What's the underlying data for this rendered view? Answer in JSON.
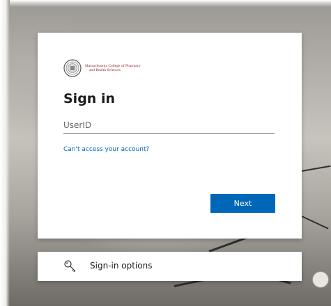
{
  "logo": {
    "line1": "Massachusetts College of Pharmacy",
    "line2": "and Health Sciences",
    "brand_color": "#8b1f2e",
    "icon": "college-seal"
  },
  "signin": {
    "title": "Sign in",
    "userid_placeholder": "UserID",
    "userid_value": "",
    "cant_access_link": "Can't access your account?",
    "next_label": "Next",
    "accent_color": "#0067b8"
  },
  "options": {
    "label": "Sign-in options",
    "icon": "key-icon"
  }
}
